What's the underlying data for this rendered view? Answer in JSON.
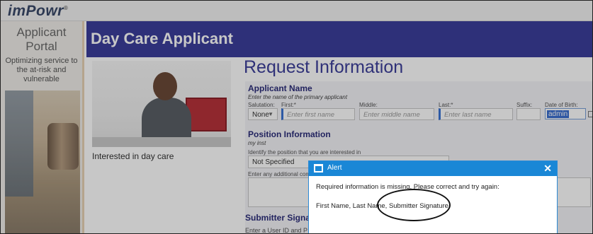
{
  "brand": {
    "logo": "imPowr",
    "mark": "®"
  },
  "sidebar": {
    "title_line1": "Applicant",
    "title_line2": "Portal",
    "tagline": "Optimizing service to the at-risk and vulnerable"
  },
  "header": {
    "title": "Day Care Applicant"
  },
  "content": {
    "photo_caption": "Interested in day care",
    "request_title": "Request Information"
  },
  "applicant_name": {
    "title": "Applicant Name",
    "subtitle": "Enter the name of the primary applicant",
    "salutation_label": "Salutation:",
    "salutation_value": "None",
    "first_label": "First:*",
    "first_placeholder": "Enter first name",
    "middle_label": "Middle:",
    "middle_placeholder": "Enter middle name",
    "last_label": "Last:*",
    "last_placeholder": "Enter last name",
    "suffix_label": "Suffix:",
    "dob_label": "Date of Birth:",
    "dob_value": "admin"
  },
  "position_info": {
    "title": "Position Information",
    "subtitle": "my inst",
    "identify_label": "Identify the position that you are interested in",
    "position_value": "Not Specified",
    "additional_label": "Enter any additional comm"
  },
  "submitter": {
    "title": "Submitter Signatu",
    "instructions": "Enter a User ID and P"
  },
  "alert": {
    "title": "Alert",
    "close": "✕",
    "message": "Required information is missing. Please correct and try again:",
    "fields": "First Name, Last Name, Submitter Signature"
  }
}
